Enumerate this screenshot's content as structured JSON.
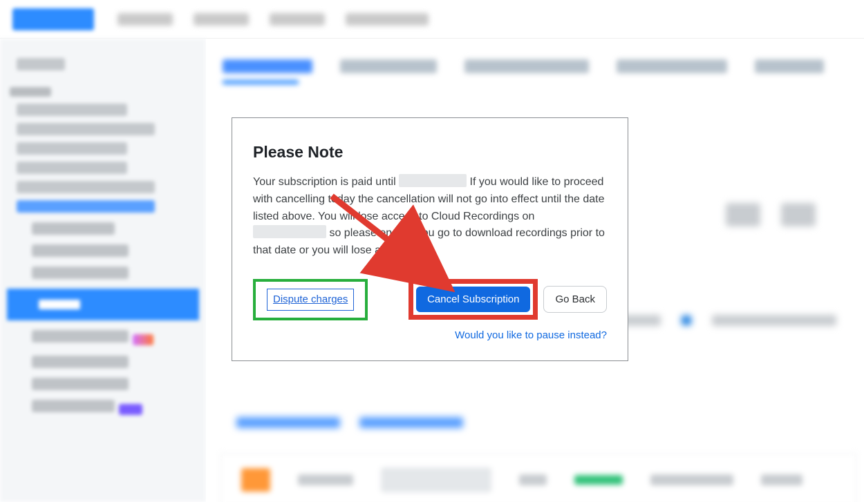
{
  "dialog": {
    "title": "Please Note",
    "body_parts": {
      "p1": "Your subscription is paid until ",
      "p2": " If you would like to proceed with cancelling today the cancellation will not go into effect until the date listed above. You will lose access to Cloud Recordings on ",
      "p3": " so please ensure you go to download recordings prior to that date or you will lose access."
    },
    "dispute_label": "Dispute charges",
    "cancel_label": "Cancel Subscription",
    "goback_label": "Go Back",
    "pause_label": "Would you like to pause instead?"
  }
}
